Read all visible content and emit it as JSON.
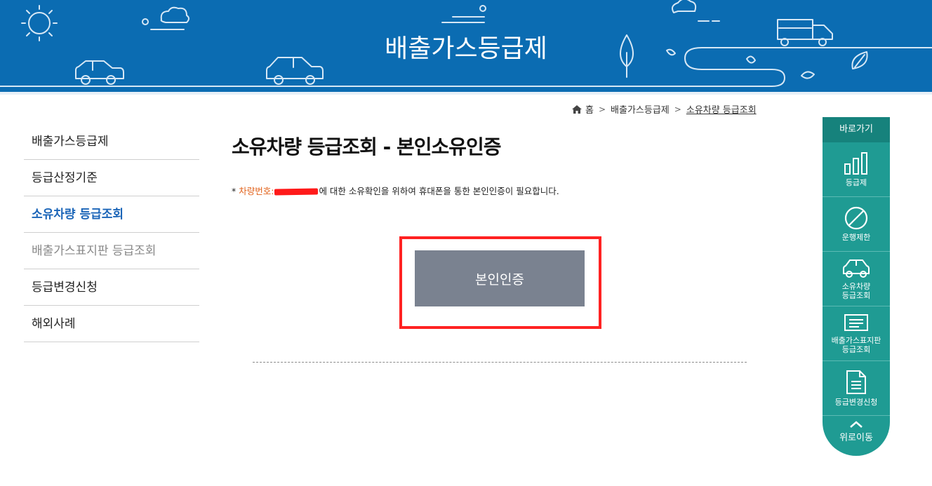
{
  "banner": {
    "title": "배출가스등급제"
  },
  "breadcrumb": {
    "home": "홈",
    "level1": "배출가스등급제",
    "current": "소유차량 등급조회"
  },
  "sidebar": {
    "items": [
      {
        "label": "배출가스등급제",
        "state": "normal"
      },
      {
        "label": "등급산정기준",
        "state": "normal"
      },
      {
        "label": "소유차량 등급조회",
        "state": "active"
      },
      {
        "label": "배출가스표지판 등급조회",
        "state": "muted"
      },
      {
        "label": "등급변경신청",
        "state": "normal"
      },
      {
        "label": "해외사례",
        "state": "normal"
      }
    ]
  },
  "main": {
    "title": "소유차량 등급조회 - 본인소유인증",
    "notice_star": "*",
    "notice_orange": "차량번호:",
    "notice_text": "에 대한 소유확인을 위하여 휴대폰을 통한 본인인증이 필요합니다.",
    "auth_button": "본인인증"
  },
  "quick_menu": {
    "title": "바로가기",
    "items": [
      {
        "label": "등급제",
        "icon": "bar-chart-icon"
      },
      {
        "label": "운행제한",
        "icon": "no-entry-icon"
      },
      {
        "label_line1": "소유차량",
        "label_line2": "등급조회",
        "icon": "car-icon"
      },
      {
        "label_line1": "배출가스표지판",
        "label_line2": "등급조회",
        "icon": "sign-board-icon"
      },
      {
        "label": "등급변경신청",
        "icon": "document-icon"
      }
    ],
    "top_label": "위로이동"
  },
  "colors": {
    "banner_blue": "#0b6cb2",
    "active_blue": "#1b65b8",
    "quick_teal": "#1f9b93",
    "button_gray": "#7a8290",
    "highlight_red": "#ff2222",
    "notice_orange": "#e2621b"
  }
}
